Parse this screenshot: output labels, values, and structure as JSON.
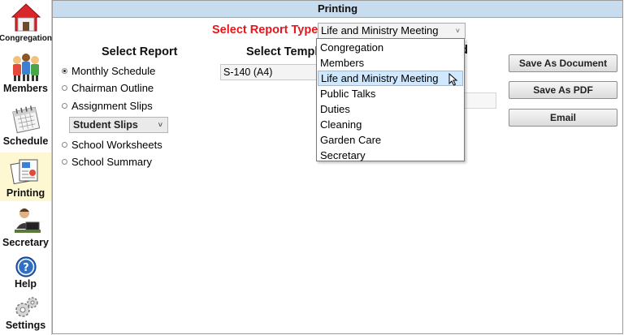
{
  "sidebar": {
    "items": [
      {
        "label": "Congregation",
        "icon": "house-icon"
      },
      {
        "label": "Members",
        "icon": "people-icon"
      },
      {
        "label": "Schedule",
        "icon": "calendar-icon"
      },
      {
        "label": "Printing",
        "icon": "documents-icon",
        "active": true
      },
      {
        "label": "Secretary",
        "icon": "secretary-icon"
      },
      {
        "label": "Help",
        "icon": "help-icon"
      },
      {
        "label": "Settings",
        "icon": "gears-icon"
      }
    ]
  },
  "header": {
    "title": "Printing"
  },
  "report_type": {
    "label": "Select Report Type",
    "value": "Life and Ministry Meeting"
  },
  "select_report": {
    "title": "Select Report",
    "options": [
      "Monthly Schedule",
      "Chairman Outline",
      "Assignment Slips",
      "School Worksheets",
      "School Summary"
    ],
    "selected": "Monthly Schedule",
    "slips_value": "Student Slips"
  },
  "select_template": {
    "title": "Select Template",
    "title_visible": "Select Templa",
    "value": "S-140 (A4)"
  },
  "col3_title_tail": "d",
  "buttons": {
    "save_document": "Save As Document",
    "save_pdf": "Save As PDF",
    "email": "Email"
  },
  "dropdown": {
    "items": [
      "Congregation",
      "Members",
      "Life and Ministry Meeting",
      "Public Talks",
      "Duties",
      "Cleaning",
      "Garden Care",
      "Secretary"
    ],
    "highlighted": "Life and Ministry Meeting"
  },
  "colors": {
    "accent_red": "#e8161b",
    "titlebar": "#c7dcef",
    "active_nav": "#fdf7d2",
    "hover": "#cde8ff"
  }
}
